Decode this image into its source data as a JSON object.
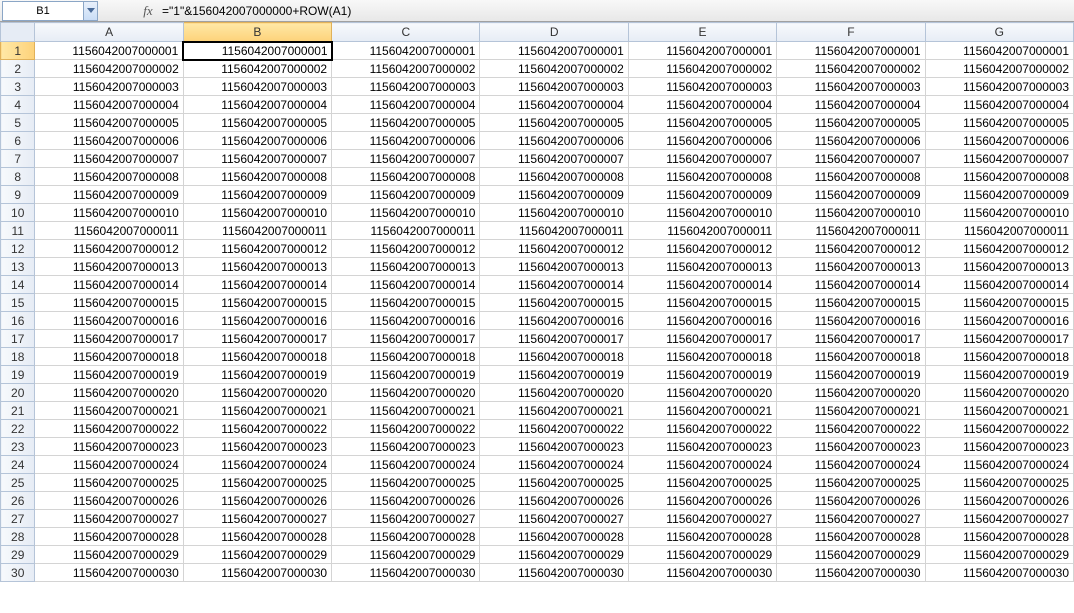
{
  "nameBox": "B1",
  "fxLabel": "fx",
  "formula": "=\"1\"&156042007000000+ROW(A1)",
  "columns": [
    "A",
    "B",
    "C",
    "D",
    "E",
    "F",
    "G"
  ],
  "rowCount": 30,
  "selectedCell": {
    "row": 1,
    "col": "B"
  },
  "cellBase": 1156042007000000,
  "chart_data": {
    "type": "table",
    "title": "",
    "note": "Every cell in row r (1..30), columns A..G, displays the value 1156042007000000 + r (i.e. 1156042007000001..1156042007000030 repeated across columns)."
  }
}
